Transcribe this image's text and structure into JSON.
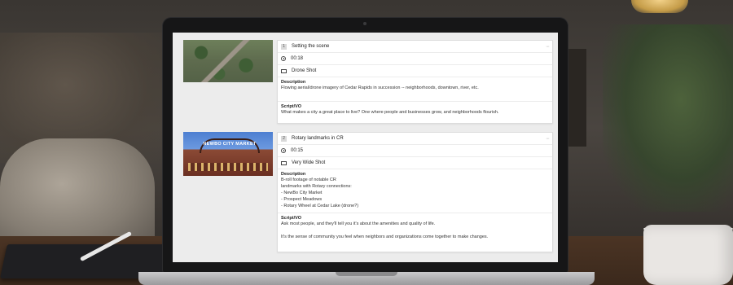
{
  "scenes": [
    {
      "number": "1",
      "title": "Setting the scene",
      "duration": "00:18",
      "shot_type": "Drone Shot",
      "description_label": "Description",
      "description_lines": [
        "Flowing aerial/drone imagery of Cedar Rapids in succession -- neighborhoods, downtown, river, etc."
      ],
      "script_label": "Script/VO",
      "script_lines": [
        "What makes a city a great place to live? One where people and businesses grow, and neighborhoods flourish."
      ],
      "menu_icon": "more-icon"
    },
    {
      "number": "2",
      "title": "Rotary landmarks in CR",
      "duration": "00:15",
      "shot_type": "Very Wide Shot",
      "description_label": "Description",
      "description_lines": [
        "B-roll footage of notable CR",
        "landmarks with Rotary connections:",
        "- NewBo City Market",
        "- Prospect Meadows",
        "- Rotary Wheel at Cedar Lake (drone?)"
      ],
      "script_label": "Script/VO",
      "script_lines": [
        "Ask most people, and they'll tell you it's about the amenities and quality of life.",
        "",
        "It's the sense of community you feel when neighbors and organizations come together to make changes."
      ],
      "thumbnail_sign": "NEWBO CITY MARKET",
      "menu_icon": "more-icon"
    }
  ]
}
